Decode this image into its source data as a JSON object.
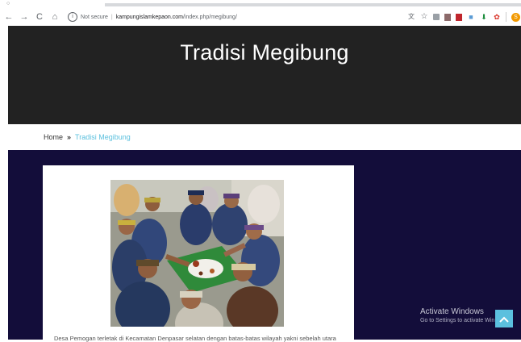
{
  "browser": {
    "nav": {
      "back": "←",
      "forward": "→",
      "reload": "C",
      "home": "⌂"
    },
    "security_label": "Not secure",
    "url_domain": "kampungislamkepaon.com",
    "url_path": "/index.php/megibung/",
    "extensions": [
      "translate-icon",
      "star-icon",
      "ext-icon-1",
      "ext-icon-2",
      "ext-icon-3",
      "download-icon",
      "ext-icon-4",
      "profile-avatar"
    ]
  },
  "header": {
    "title": "Tradisi Megibung"
  },
  "breadcrumb": {
    "home": "Home",
    "separator": "»",
    "current": "Tradisi Megibung"
  },
  "article": {
    "image_alt": "Men in traditional udeng headdresses sharing a megibung meal",
    "text": "Desa Pemogan terletak di Kecamatan Denpasar selatan dengan batas-batas wilayah yakni sebelah utara"
  },
  "watermark": {
    "line1": "Activate Windows",
    "line2": "Go to Settings to activate Win"
  },
  "scroll_top": {
    "icon": "chevron-up-icon"
  },
  "colors": {
    "header_bg": "#222222",
    "main_bg": "#130d3a",
    "accent": "#5bc0de"
  }
}
